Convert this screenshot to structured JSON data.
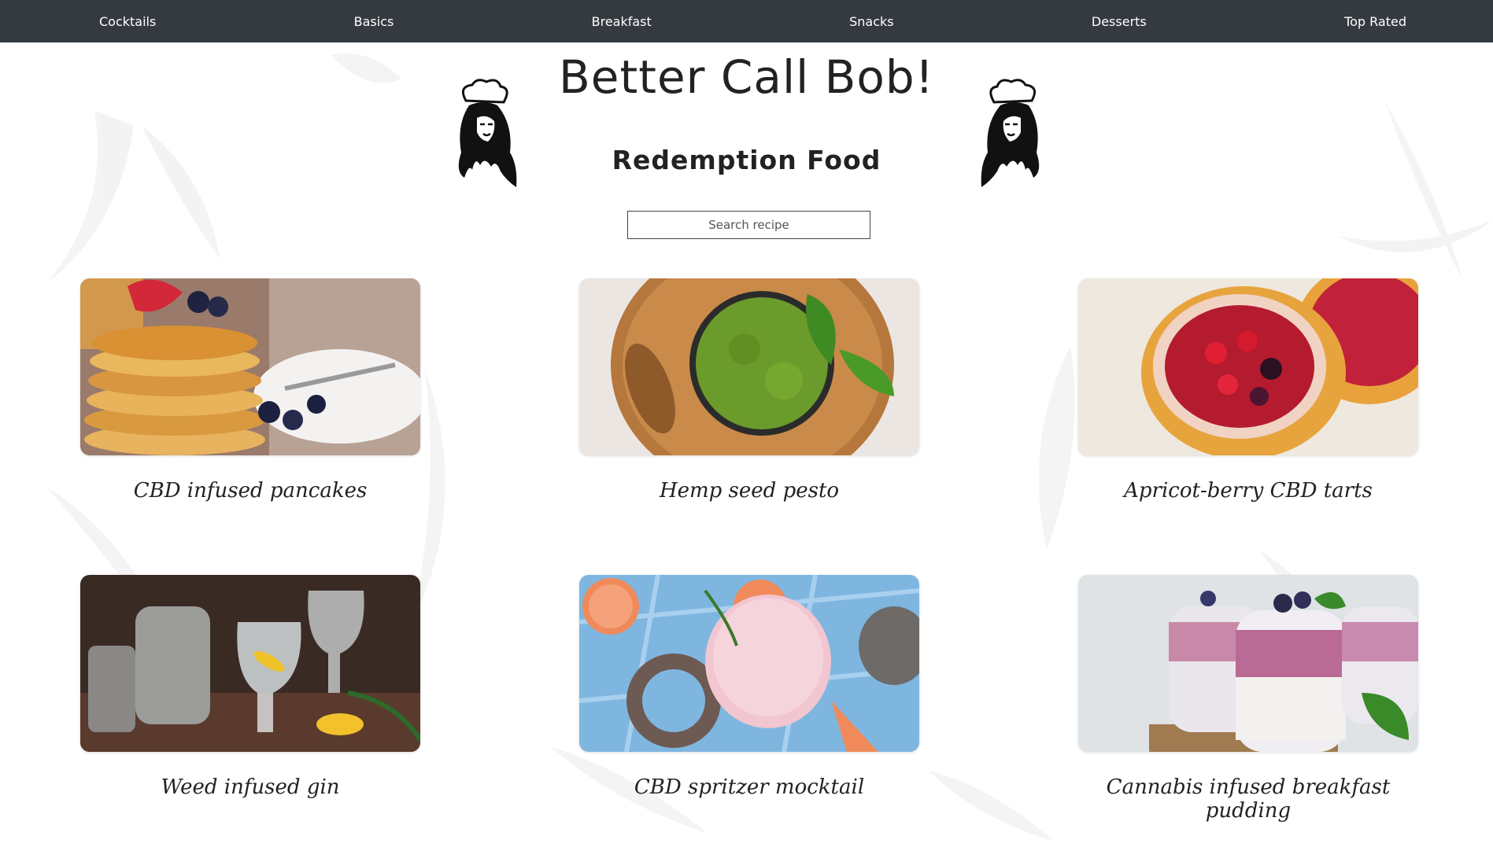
{
  "nav": {
    "items": [
      "Cocktails",
      "Basics",
      "Breakfast",
      "Snacks",
      "Desserts",
      "Top Rated"
    ]
  },
  "header": {
    "title": "Better Call Bob!",
    "subtitle": "Redemption Food"
  },
  "search": {
    "placeholder": "Search recipe"
  },
  "recipes": [
    {
      "title": "CBD infused pancakes",
      "image": "pancakes-photo"
    },
    {
      "title": "Hemp seed pesto",
      "image": "pesto-photo"
    },
    {
      "title": "Apricot-berry CBD tarts",
      "image": "tarts-photo"
    },
    {
      "title": "Weed infused gin",
      "image": "gin-photo"
    },
    {
      "title": "CBD spritzer mocktail",
      "image": "mocktail-photo"
    },
    {
      "title": "Cannabis infused breakfast pudding",
      "image": "pudding-photo"
    }
  ],
  "colors": {
    "navbar": "#343a40",
    "nav_text": "#ffffff",
    "background": "#ffffff"
  }
}
